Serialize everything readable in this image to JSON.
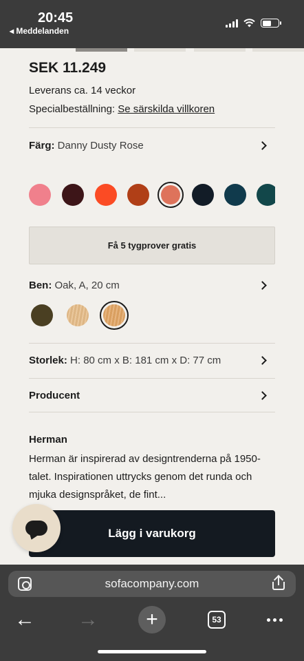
{
  "status_bar": {
    "time": "20:45",
    "back_label": "◂ Meddelanden"
  },
  "product": {
    "price": "SEK 11.249",
    "delivery": "Leverans ca. 14 veckor",
    "special_order_label": "Specialbeställning:",
    "special_order_link": "Se särskilda villkoren"
  },
  "color_option": {
    "label": "Färg:",
    "value": "Danny Dusty Rose",
    "swatches": [
      {
        "color": "#f0808c"
      },
      {
        "color": "#3d1518"
      },
      {
        "color": "#fb4b24"
      },
      {
        "color": "#b03f17"
      },
      {
        "color": "#de735b",
        "selected": true
      },
      {
        "color": "#121c27"
      },
      {
        "color": "#103a4c"
      },
      {
        "color": "#12474a"
      }
    ]
  },
  "samples_button": "Få 5 tygprover gratis",
  "legs_option": {
    "label": "Ben:",
    "value": "Oak, A, 20 cm",
    "swatches": [
      {
        "color": "#4a3f22"
      },
      {
        "color": "#e6bc88"
      },
      {
        "color": "#e2a564",
        "selected": true
      }
    ]
  },
  "size_option": {
    "label": "Storlek:",
    "value": "H: 80 cm x B: 181 cm x D: 77 cm"
  },
  "producer_option": {
    "label": "Producent"
  },
  "description": {
    "title": "Herman",
    "text": "Herman är inspirerad av designtrenderna på 1950-talet. Inspirationen uttrycks genom det runda och mjuka designspråket, de fint..."
  },
  "cart_button": "Lägg i varukorg",
  "browser": {
    "url": "sofacompany.com",
    "tab_count": "53"
  }
}
